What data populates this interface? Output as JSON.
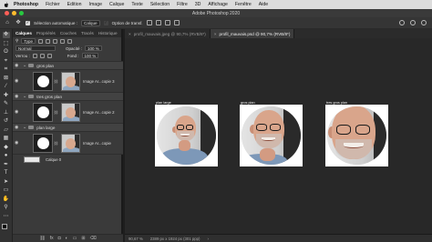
{
  "menubar": {
    "app": "Photoshop",
    "items": [
      "Fichier",
      "Edition",
      "Image",
      "Calque",
      "Texte",
      "Sélection",
      "Filtre",
      "3D",
      "Affichage",
      "Fenêtre",
      "Aide"
    ]
  },
  "window": {
    "title": "Adobe Photoshop 2020"
  },
  "options": {
    "auto_select_label": "Sélection automatique :",
    "auto_select_target": "Calque",
    "show_transform_label": "Option de transf."
  },
  "panel": {
    "tabs": [
      "Calques",
      "Propriétés",
      "Couches",
      "Tracés",
      "Historique"
    ],
    "filter_label": "Type",
    "blend_mode": "Normal",
    "opacity_label": "Opacité :",
    "opacity_value": "100 %",
    "lock_label": "Verrou :",
    "fill_label": "Fond :",
    "fill_value": "100 %"
  },
  "layers": [
    {
      "group": "gros plan",
      "layer": "Image Ar...copie 3"
    },
    {
      "group": "tres gros plan",
      "layer": "Image Ar...copie 2"
    },
    {
      "group": "plan large",
      "layer": "Image Ar...copie"
    }
  ],
  "background_layer": "Calque 0",
  "footer_icons": [
    "link-icon",
    "fx-icon",
    "mask-icon",
    "adjustment-icon",
    "folder-icon",
    "new-layer-icon",
    "trash-icon"
  ],
  "doc_tabs": [
    {
      "label": "profil_mauvais.jpeg @ 90,7% (RVB/8*)",
      "active": false
    },
    {
      "label": "profil_mauvais.psd @ 90,7% (RVB/8*)",
      "active": true
    }
  ],
  "canvas": {
    "captions": [
      "plan large",
      "gros plan",
      "tres gros plan"
    ]
  },
  "status": {
    "zoom": "90,67 %",
    "doc_size": "2389 px x 1924 px (301 ppp)"
  },
  "colors": {
    "menubar": "#dcdcdc",
    "panel": "#3a3a3a",
    "canvas": "#282828",
    "close": "#ff5f57",
    "minimize": "#febc2e",
    "zoom": "#28c840"
  }
}
